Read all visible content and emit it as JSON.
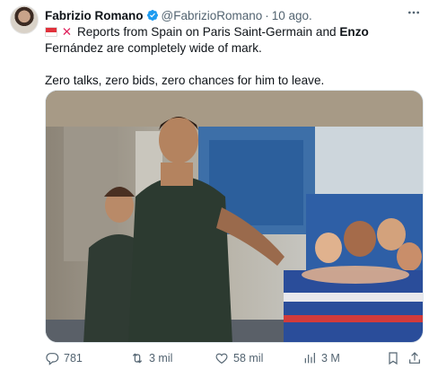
{
  "author": {
    "name": "Fabrizio Romano",
    "handle": "@FabrizioRomano",
    "separator": "·",
    "time": "10 ago."
  },
  "tweet": {
    "line1_pre": "Reports from Spain on Paris Saint-Germain and ",
    "line1_bold": "Enzo",
    "line1_post": " Fernández are completely wide of mark.",
    "line2": "Zero talks, zero bids, zero chances for him to leave."
  },
  "actions": {
    "replies": "781",
    "reposts": "3 mil",
    "likes": "58 mil",
    "views": "3 M"
  },
  "icons": [
    "verified-badge-icon",
    "more-icon",
    "flag-icon",
    "cross-mark-icon",
    "reply-icon",
    "repost-icon",
    "like-icon",
    "views-icon",
    "bookmark-icon",
    "share-icon"
  ],
  "colors": {
    "verified": "#1d9bf0",
    "muted": "#536471",
    "text": "#0f1419",
    "cross": "#e0245e"
  }
}
